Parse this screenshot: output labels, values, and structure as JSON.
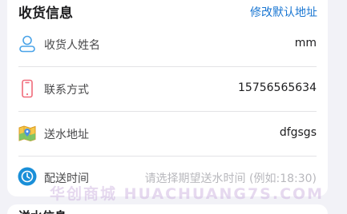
{
  "section": {
    "title": "收货信息",
    "edit_link": "修改默认地址"
  },
  "rows": [
    {
      "icon": "person-icon",
      "label": "收货人姓名",
      "value": "mm"
    },
    {
      "icon": "phone-icon",
      "label": "联系方式",
      "value": "15756565634"
    },
    {
      "icon": "map-icon",
      "label": "送水地址",
      "value": "dfgsgs"
    },
    {
      "icon": "clock-icon",
      "label": "配送时间",
      "placeholder": "请选择期望送水时间 (例如:18:30)"
    }
  ],
  "watermark": "华创商城 HUACHUANG7S.COM",
  "next_section": {
    "title": "送水信息"
  },
  "colors": {
    "accent": "#1976d2",
    "person_icon": "#4aa3e8",
    "phone_icon": "#f06b7a",
    "clock_icon": "#1a8fd8",
    "map_icon": "#f2b233"
  }
}
